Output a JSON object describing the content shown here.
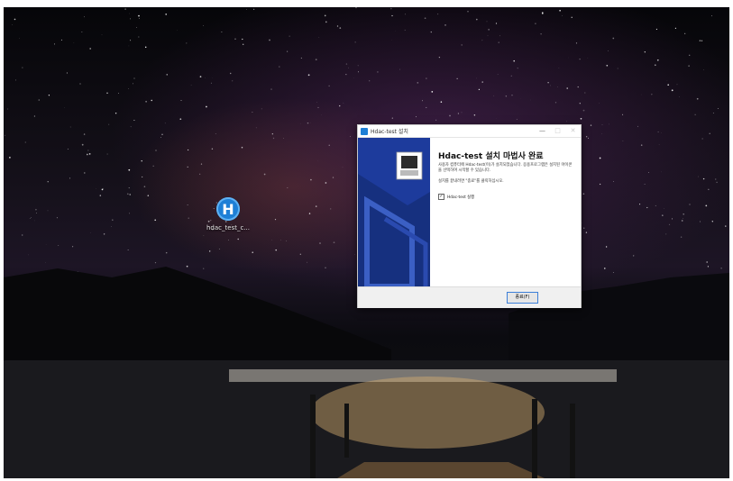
{
  "desktop": {
    "icon_label": "hdac_test_c..."
  },
  "installer": {
    "window_title": "Hdac-test 설치",
    "heading": "Hdac-test 설치 마법사 완료",
    "paragraph1": "사용자 컴퓨터에 Hdac-test(이)가 설치되었습니다. 응용프로그램은 설치된 아이콘을 선택하여 시작할 수 있습니다.",
    "paragraph2": "설치를 끝내려면 \"종료\"를 클릭하십시오.",
    "checkbox_label": "Hdac-test 실행",
    "checkbox_checked": true,
    "finish_button": "종료(F)",
    "minimize_glyph": "—",
    "maximize_glyph": "□",
    "close_glyph": "✕"
  },
  "colors": {
    "sidebar_blue": "#1d3b9c",
    "accent": "#3c7fd8",
    "app_icon": "#1e7fd6"
  },
  "icons": {
    "desktop_icon": "hdac-logo-icon",
    "installer_graphic": "computer-install-icon"
  }
}
